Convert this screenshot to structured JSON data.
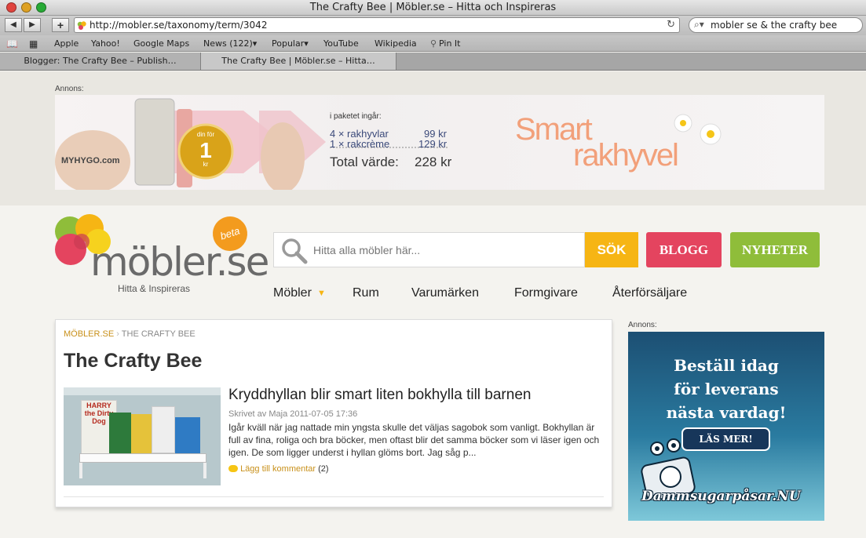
{
  "browser": {
    "window_title": "The Crafty Bee | Möbler.se – Hitta och Inspireras",
    "url": "http://mobler.se/taxonomy/term/3042",
    "search_value": "mobler se & the crafty bee",
    "bookmarks": [
      "Apple",
      "Yahoo!",
      "Google Maps",
      "News (122)▾",
      "Popular▾",
      "YouTube",
      "Wikipedia",
      "Pin It"
    ],
    "tabs": [
      "Blogger: The Crafty Bee – Publish…",
      "The Crafty Bee | Möbler.se – Hitta…"
    ]
  },
  "top_ad": {
    "annons_label": "Annons:",
    "brand": "MYHYGO.com",
    "badge_small": "din för",
    "badge_price": "1",
    "badge_unit": "kr",
    "package_intro": "i paketet ingår:",
    "row1_item": "4 × rakhyvlar",
    "row1_price": "99 kr",
    "row2_item": "1 × rakcrème",
    "row2_price": "129 kr",
    "total_label": "Total värde:",
    "total_price": "228 kr",
    "slogan1": "Smart",
    "slogan2": "rakhyvel"
  },
  "header": {
    "logo_text": "möbler.se",
    "beta": "beta",
    "tagline": "Hitta & Inspireras",
    "search_placeholder": "Hitta alla möbler här...",
    "search_button": "SÖK",
    "blogg_button": "BLOGG",
    "nyheter_button": "NYHETER",
    "nav": [
      "Möbler",
      "Rum",
      "Varumärken",
      "Formgivare",
      "Återförsäljare"
    ]
  },
  "content": {
    "breadcrumb_root": "MÖBLER.SE",
    "breadcrumb_current": "THE CRAFTY BEE",
    "page_title": "The Crafty Bee",
    "post": {
      "title": "Kryddhyllan blir smart liten bokhylla till barnen",
      "meta": "Skrivet av Maja 2011-07-05 17:36",
      "excerpt": "Igår kväll när jag nattade min yngsta skulle det väljas sagobok som vanligt. Bokhyllan är full av fina, roliga och bra böcker, men oftast blir det samma böcker som vi läser igen och igen. De som ligger underst i hyllan glöms bort. Jag såg p...",
      "comment_link": "Lägg till kommentar",
      "comment_count": "(2)",
      "thumb_book": "HARRY the Dirty Dog"
    }
  },
  "side_ad": {
    "annons_label": "Annons:",
    "headline1": "Beställ idag",
    "headline2": "för leverans",
    "headline3": "nästa vardag!",
    "cta": "LÄS MER!",
    "brand": "Dammsugarpåsar.NU"
  },
  "colors": {
    "search_yellow": "#f6b514",
    "blogg_pink": "#e4445f",
    "nyheter_green": "#8fbd3a",
    "accent_gold": "#c8901a"
  }
}
